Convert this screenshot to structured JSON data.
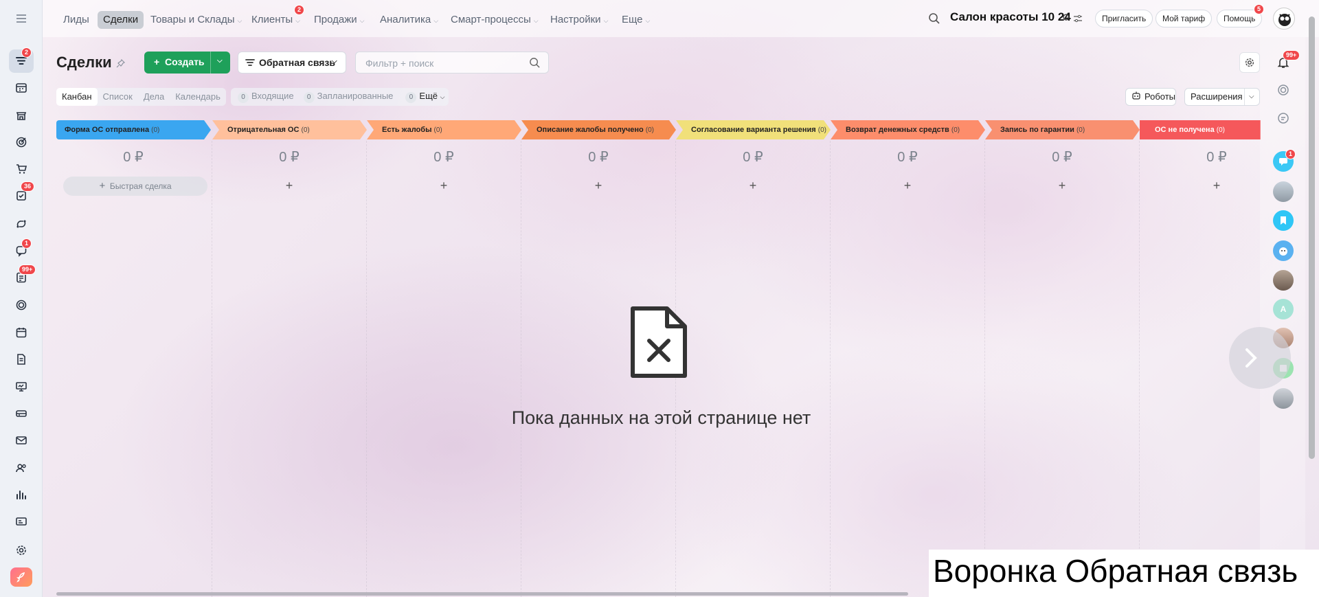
{
  "topnav": {
    "items": [
      {
        "label": "Лиды",
        "dropdown": false
      },
      {
        "label": "Сделки",
        "dropdown": false,
        "active": true
      },
      {
        "label": "Товары и Склады",
        "dropdown": true
      },
      {
        "label": "Клиенты",
        "dropdown": true,
        "badge": "2"
      },
      {
        "label": "Продажи",
        "dropdown": true
      },
      {
        "label": "Аналитика",
        "dropdown": true
      },
      {
        "label": "Смарт-процессы",
        "dropdown": true
      },
      {
        "label": "Настройки",
        "dropdown": true
      },
      {
        "label": "Еще",
        "dropdown": true
      }
    ],
    "company": "Салон красоты 10 24",
    "invite_label": "Пригласить",
    "tariff_label": "Мой тариф",
    "help_label": "Помощь",
    "help_badge": "5"
  },
  "left_sidebar": {
    "icons": [
      {
        "name": "menu-icon"
      },
      {
        "name": "funnel-icon",
        "badge": "2",
        "active": true
      },
      {
        "name": "calendar-grid-icon"
      },
      {
        "name": "store-icon"
      },
      {
        "name": "target-icon"
      },
      {
        "name": "cart-icon"
      },
      {
        "name": "tasks-icon",
        "badge": "36"
      },
      {
        "name": "flow-icon"
      },
      {
        "name": "chat-icon",
        "badge": "1"
      },
      {
        "name": "feed-icon",
        "badge": "99+"
      },
      {
        "name": "ring-icon"
      },
      {
        "name": "calendar-icon"
      },
      {
        "name": "document-icon"
      },
      {
        "name": "presentation-icon"
      },
      {
        "name": "drive-icon"
      },
      {
        "name": "mail-icon"
      },
      {
        "name": "contacts-icon"
      },
      {
        "name": "chart-icon"
      },
      {
        "name": "id-card-icon"
      },
      {
        "name": "settings-icon"
      },
      {
        "name": "rocket-icon"
      }
    ]
  },
  "toolbar": {
    "title": "Сделки",
    "create_label": "Создать",
    "funnel_label": "Обратная связь",
    "filter_placeholder": "Фильтр + поиск",
    "views": [
      "Канбан",
      "Список",
      "Дела",
      "Календарь"
    ],
    "active_view": "Канбан",
    "counters": [
      {
        "count": "0",
        "label": "Входящие"
      },
      {
        "count": "0",
        "label": "Запланированные"
      },
      {
        "count": "0",
        "label": "Ещё"
      }
    ],
    "robots_label": "Роботы",
    "extensions_label": "Расширения"
  },
  "notifications_badge": "99+",
  "stages": [
    {
      "name": "Форма ОС отправлена",
      "count": "(0)",
      "sum": "0 ₽",
      "color": "#3aa6f0"
    },
    {
      "name": "Отрицательная ОС",
      "count": "(0)",
      "sum": "0 ₽",
      "color": "#ffc09c"
    },
    {
      "name": "Есть жалобы",
      "count": "(0)",
      "sum": "0 ₽",
      "color": "#ffa877"
    },
    {
      "name": "Описание жалобы получено",
      "count": "(0)",
      "sum": "0 ₽",
      "color": "#f68c4f"
    },
    {
      "name": "Согласование варианта решения",
      "count": "(0)",
      "sum": "0 ₽",
      "color": "#f1e07a"
    },
    {
      "name": "Возврат денежных средств",
      "count": "(0)",
      "sum": "0 ₽",
      "color": "#fd8d6b"
    },
    {
      "name": "Запись по гарантии",
      "count": "(0)",
      "sum": "0 ₽",
      "color": "#f99070"
    },
    {
      "name": "ОС не получена",
      "count": "(0)",
      "sum": "0 ₽",
      "color": "#f5585b"
    }
  ],
  "quick_deal_label": "Быстрая сделка",
  "empty_state": "Пока данных на этой странице нет",
  "right_sidebar": {
    "chat_badge": "1",
    "avatars": [
      "avatar-landscape",
      "avatar-bookmark",
      "avatar-dog",
      "avatar-man",
      "avatar-letter",
      "avatar-woman",
      "avatar-notes",
      "avatar-gray"
    ],
    "letter_avatar": "A"
  },
  "caption": "Воронка Обратная связь"
}
